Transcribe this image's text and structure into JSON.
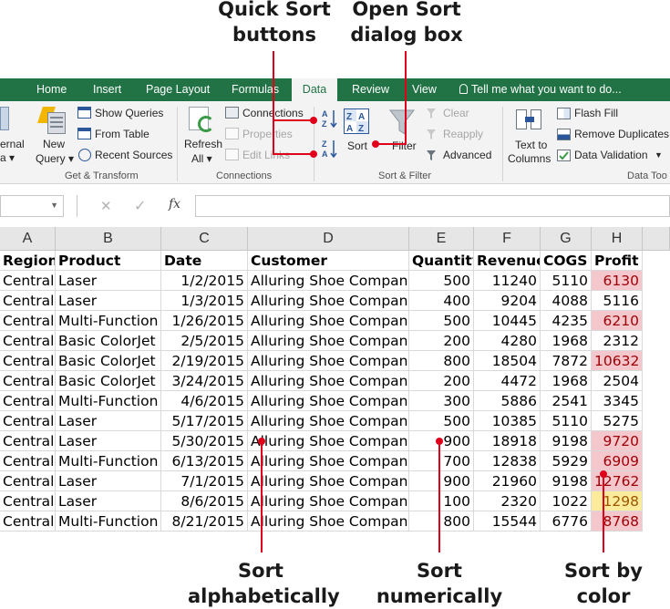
{
  "callouts": {
    "quick_sort_line1": "Quick Sort",
    "quick_sort_line2": "buttons",
    "open_sort_line1": "Open Sort",
    "open_sort_line2": "dialog box",
    "sort_alpha_line1": "Sort",
    "sort_alpha_line2": "alphabetically",
    "sort_num_line1": "Sort",
    "sort_num_line2": "numerically",
    "sort_color_line1": "Sort by",
    "sort_color_line2": "color"
  },
  "tabs": [
    {
      "label": "Home"
    },
    {
      "label": "Insert"
    },
    {
      "label": "Page Layout"
    },
    {
      "label": "Formulas"
    },
    {
      "label": "Data"
    },
    {
      "label": "Review"
    },
    {
      "label": "View"
    },
    {
      "label": "Tell me what you want to do..."
    }
  ],
  "ribbon": {
    "get_external_1": "ernal",
    "get_external_2": "a ▾",
    "new_query_1": "New",
    "new_query_2": "Query ▾",
    "show_queries": "Show Queries",
    "from_table": "From Table",
    "recent_sources": "Recent Sources",
    "group_get_transform": "Get & Transform",
    "refresh_all_1": "Refresh",
    "refresh_all_2": "All ▾",
    "connections": "Connections",
    "properties": "Properties",
    "edit_links": "Edit Links",
    "group_connections": "Connections",
    "sort": "Sort",
    "filter": "Filter",
    "clear": "Clear",
    "reapply": "Reapply",
    "advanced": "Advanced",
    "group_sort_filter": "Sort & Filter",
    "text_to_columns_1": "Text to",
    "text_to_columns_2": "Columns",
    "flash_fill": "Flash Fill",
    "remove_duplicates": "Remove Duplicates",
    "data_validation": "Data Validation",
    "group_data_tools": "Data Too"
  },
  "formula_bar": {
    "fx": "fx",
    "cancel": "✕",
    "enter": "✓"
  },
  "columns": [
    "A",
    "B",
    "C",
    "D",
    "E",
    "F",
    "G",
    "H"
  ],
  "header_row": [
    "Region",
    "Product",
    "Date",
    "Customer",
    "Quantity",
    "Revenue",
    "COGS",
    "Profit"
  ],
  "rows": [
    [
      "Central",
      "Laser",
      "1/2/2015",
      "Alluring Shoe Company",
      "500",
      "11240",
      "5110",
      "6130"
    ],
    [
      "Central",
      "Laser",
      "1/3/2015",
      "Alluring Shoe Company",
      "400",
      "9204",
      "4088",
      "5116"
    ],
    [
      "Central",
      "Multi-Function",
      "1/26/2015",
      "Alluring Shoe Company",
      "500",
      "10445",
      "4235",
      "6210"
    ],
    [
      "Central",
      "Basic ColorJet",
      "2/5/2015",
      "Alluring Shoe Company",
      "200",
      "4280",
      "1968",
      "2312"
    ],
    [
      "Central",
      "Basic ColorJet",
      "2/19/2015",
      "Alluring Shoe Company",
      "800",
      "18504",
      "7872",
      "10632"
    ],
    [
      "Central",
      "Basic ColorJet",
      "3/24/2015",
      "Alluring Shoe Company",
      "200",
      "4472",
      "1968",
      "2504"
    ],
    [
      "Central",
      "Multi-Function",
      "4/6/2015",
      "Alluring Shoe Company",
      "300",
      "5886",
      "2541",
      "3345"
    ],
    [
      "Central",
      "Laser",
      "5/17/2015",
      "Alluring Shoe Company",
      "500",
      "10385",
      "5110",
      "5275"
    ],
    [
      "Central",
      "Laser",
      "5/30/2015",
      "Alluring Shoe Company",
      "900",
      "18918",
      "9198",
      "9720"
    ],
    [
      "Central",
      "Multi-Function",
      "6/13/2015",
      "Alluring Shoe Company",
      "700",
      "12838",
      "5929",
      "6909"
    ],
    [
      "Central",
      "Laser",
      "7/1/2015",
      "Alluring Shoe Company",
      "900",
      "21960",
      "9198",
      "12762"
    ],
    [
      "Central",
      "Laser",
      "8/6/2015",
      "Alluring Shoe Company",
      "100",
      "2320",
      "1022",
      "1298"
    ],
    [
      "Central",
      "Multi-Function",
      "8/21/2015",
      "Alluring Shoe Company",
      "800",
      "15544",
      "6776",
      "8768"
    ]
  ],
  "profit_highlight": [
    "pink",
    "none",
    "pink",
    "none",
    "pink",
    "none",
    "none",
    "none",
    "pink",
    "pink",
    "pink",
    "yellow",
    "pink"
  ],
  "colors": {
    "excel_green": "#217346",
    "callout_red": "#e0001b",
    "highlight_pink": "#f4c7cc",
    "highlight_yellow": "#fdeb9c"
  }
}
